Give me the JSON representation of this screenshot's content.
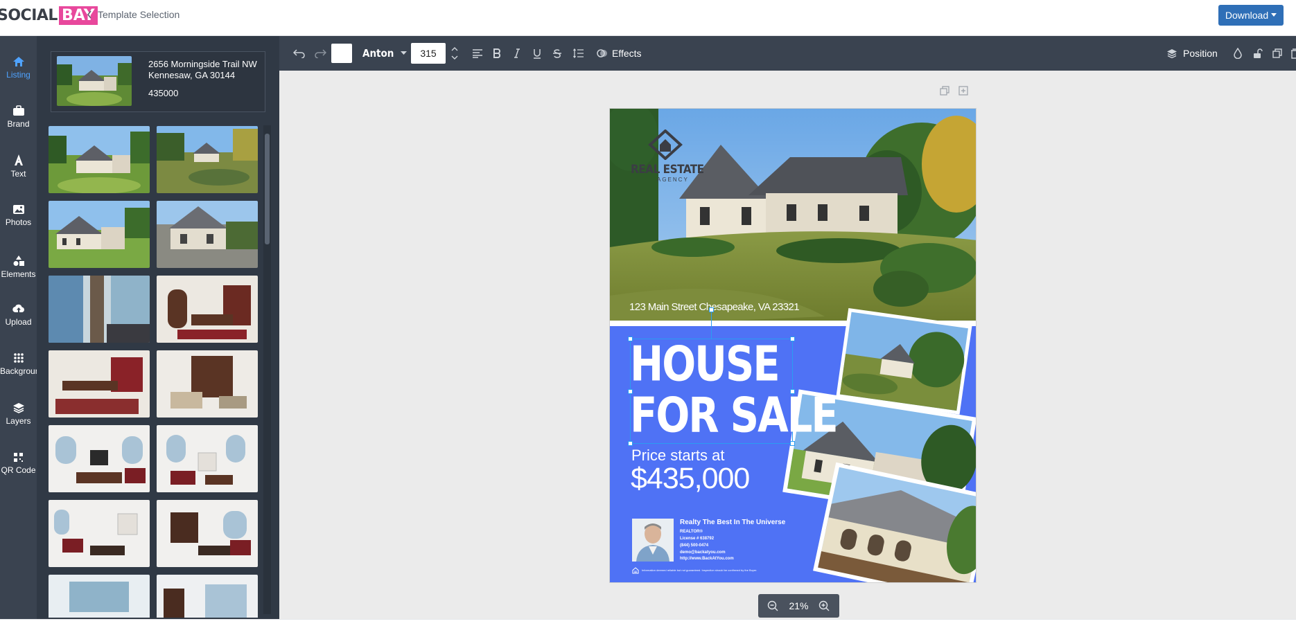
{
  "header": {
    "logo_part1": "SOCIAL",
    "logo_part2": "BAY",
    "back_label": "Template Selection",
    "download_label": "Download"
  },
  "nav": {
    "items": [
      {
        "label": "Listing",
        "icon": "home-icon"
      },
      {
        "label": "Brand",
        "icon": "briefcase-icon"
      },
      {
        "label": "Text",
        "icon": "text-icon"
      },
      {
        "label": "Photos",
        "icon": "image-icon"
      },
      {
        "label": "Elements",
        "icon": "shapes-icon"
      },
      {
        "label": "Upload",
        "icon": "upload-icon"
      },
      {
        "label": "Background",
        "icon": "grid-dots-icon"
      },
      {
        "label": "Layers",
        "icon": "layers-icon"
      },
      {
        "label": "QR Code",
        "icon": "qr-icon"
      }
    ]
  },
  "listing": {
    "address_line1": "2656 Morningside Trail NW",
    "address_line2": "Kennesaw, GA 30144",
    "price": "435000"
  },
  "toolbar": {
    "font_name": "Anton",
    "font_size": "315",
    "effects_label": "Effects",
    "position_label": "Position",
    "text_color": "#ffffff"
  },
  "canvas": {
    "address": "123 Main Street Chesapeake, VA 23321",
    "headline_line1": "HOUSE",
    "headline_line2": "FOR SALE",
    "price_label": "Price starts at",
    "price_value": "$435,000",
    "brand_line1": "REAL ESTATE",
    "brand_line2": "AGENCY",
    "agent_company": "Realty The Best In The Universe",
    "agent_title": "REALTOR®",
    "agent_license": "License # 638792",
    "agent_phone": "(844) 500-0474",
    "agent_email": "demo@backatyou.com",
    "agent_site": "http://www.BackAtYou.com",
    "disclaimer": "Information deemed reliable but not guaranteed. Inspection should be confirmed by the Buyer.",
    "background_color": "#4f72f5"
  },
  "zoom": {
    "level": "21%"
  }
}
